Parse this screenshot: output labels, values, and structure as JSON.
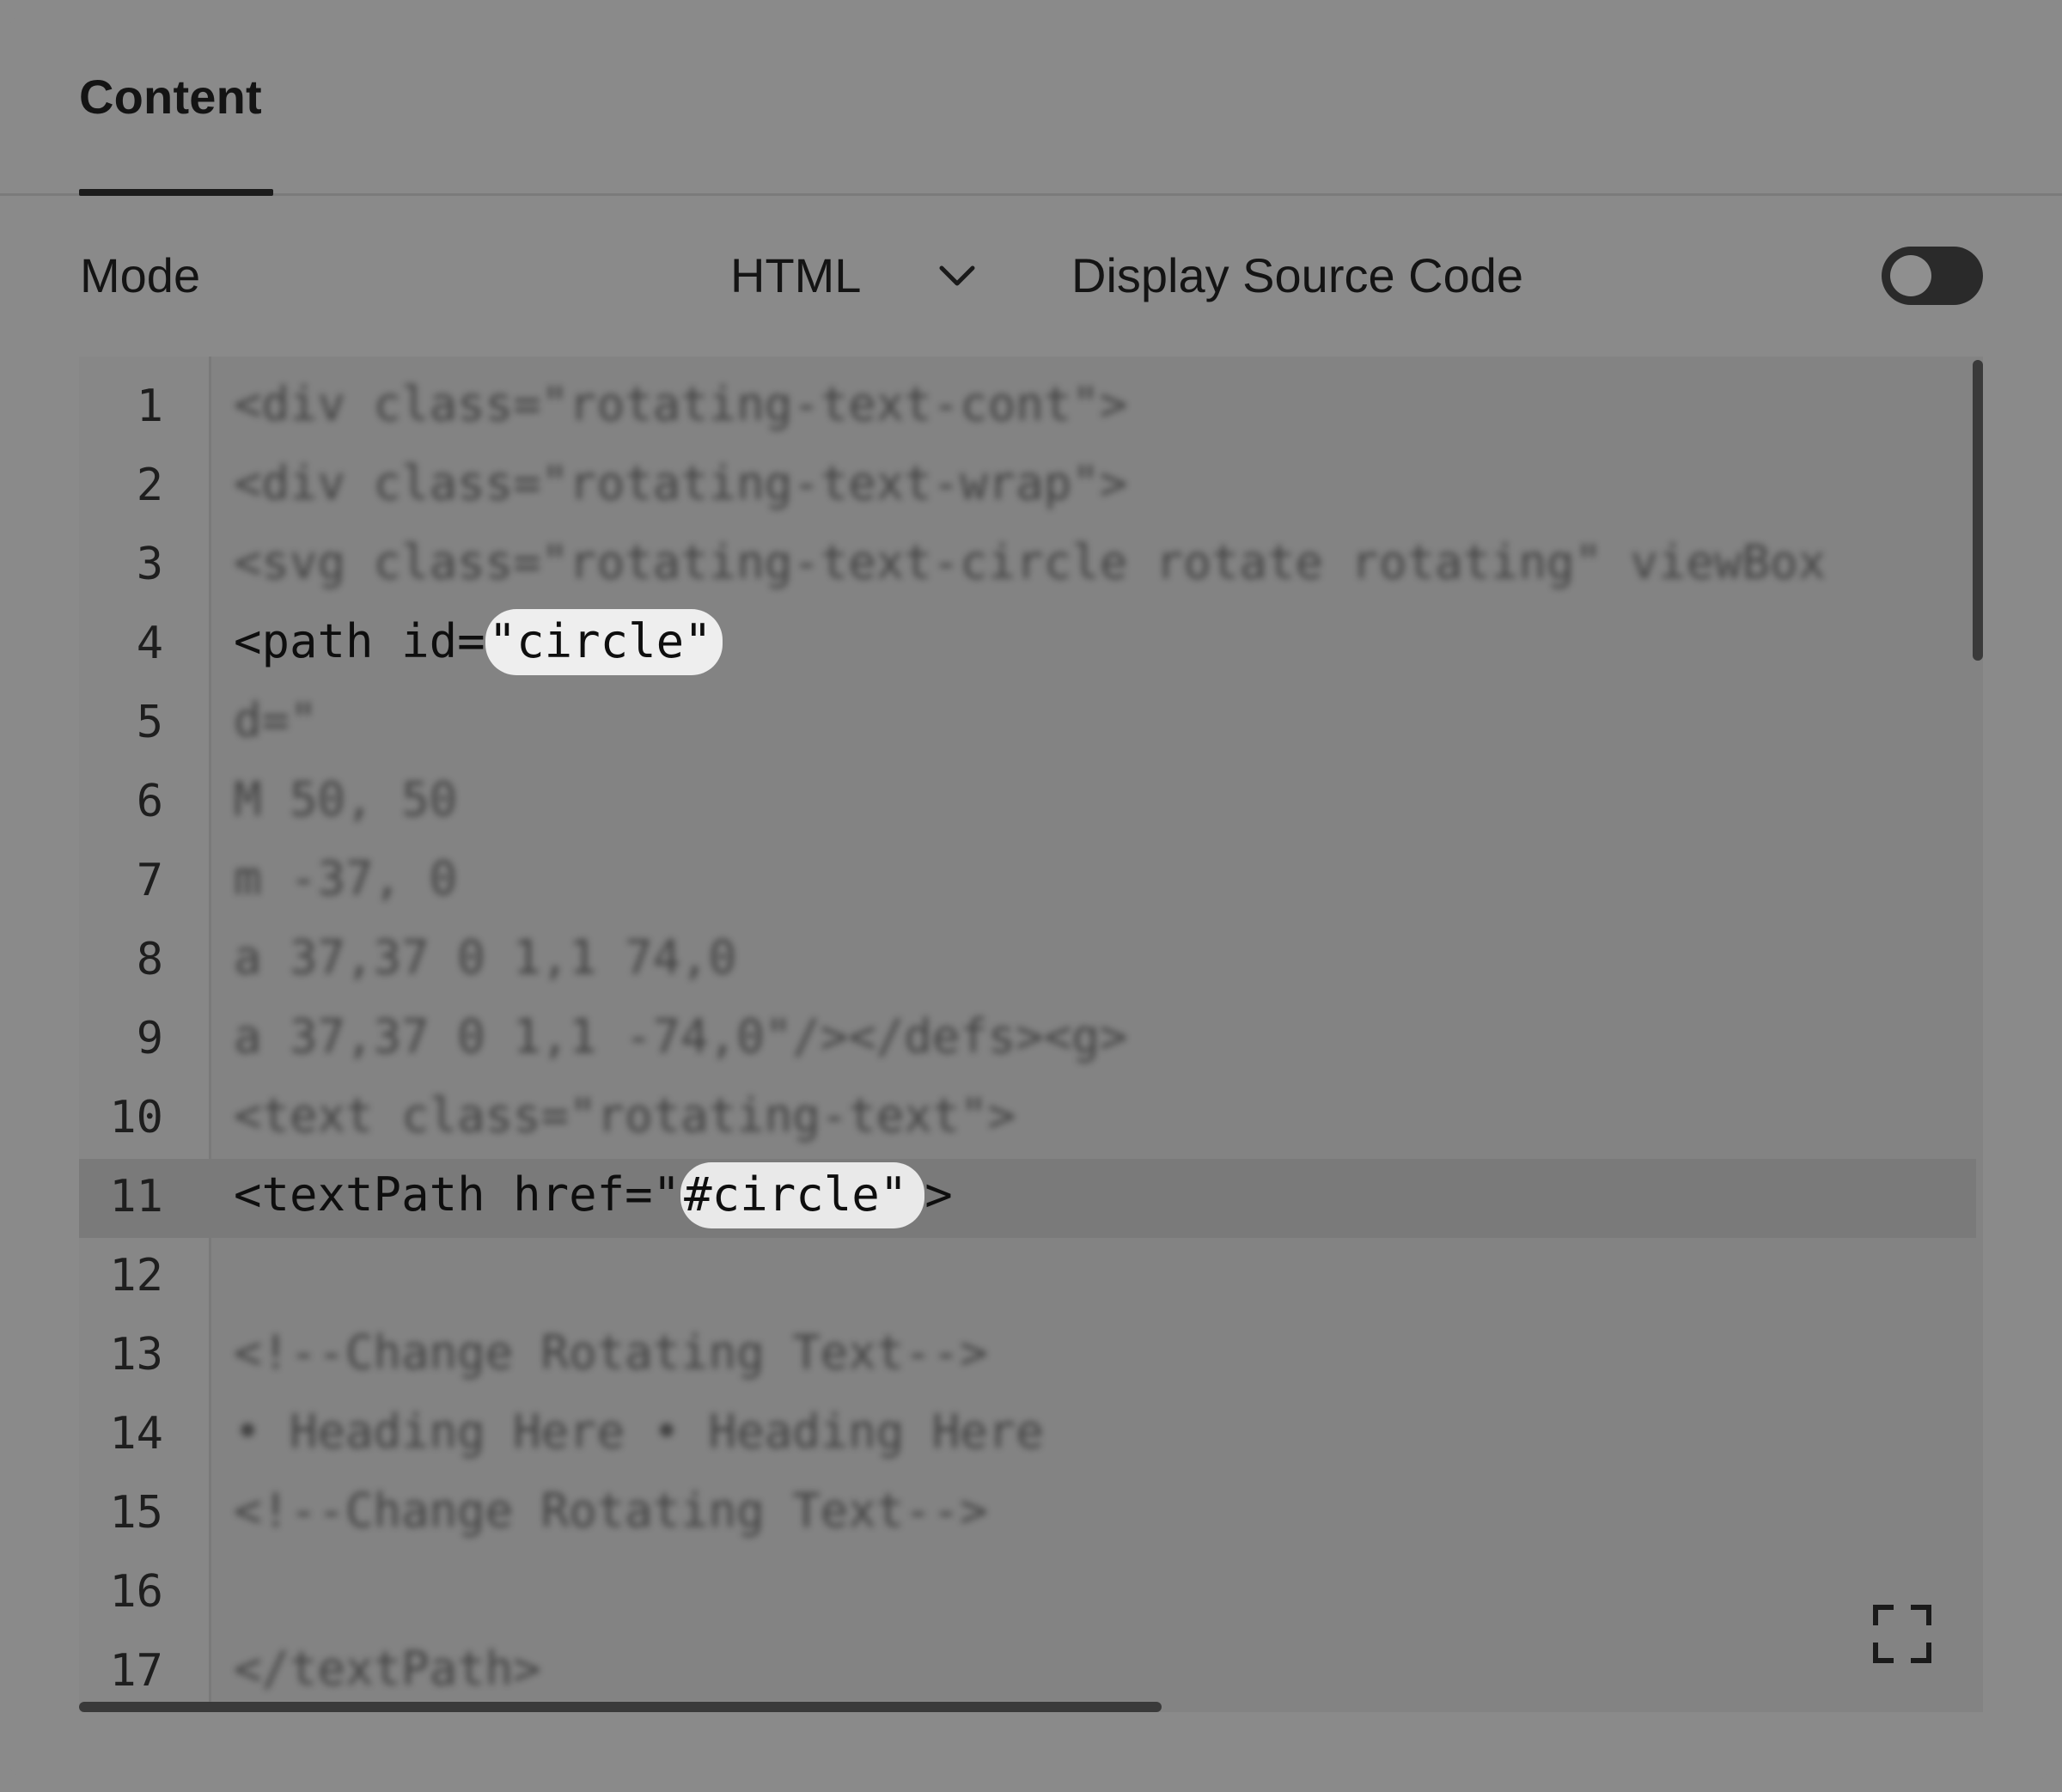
{
  "tabs": [
    {
      "label": "Content"
    }
  ],
  "mode": {
    "label": "Mode",
    "selected": "HTML",
    "display_source_label": "Display Source Code",
    "display_source_enabled": false
  },
  "icons": {
    "mode_dropdown": "chevron-down-icon",
    "expand": "expand-icon"
  },
  "editor": {
    "active_line": 11,
    "lines": [
      {
        "num": "1",
        "text": "<div class=\"rotating-text-cont\">",
        "blurred": true
      },
      {
        "num": "2",
        "text": "<div class=\"rotating-text-wrap\">",
        "blurred": true
      },
      {
        "num": "3",
        "text": "<svg class=\"rotating-text-circle rotate rotating\" viewBox",
        "blurred": true
      },
      {
        "num": "4",
        "pre": "<path id=",
        "highlight": "\"circle\"",
        "post": ""
      },
      {
        "num": "5",
        "text": "d=\"",
        "blurred": true
      },
      {
        "num": "6",
        "text": "M 50, 50",
        "blurred": true
      },
      {
        "num": "7",
        "text": "m -37, 0",
        "blurred": true
      },
      {
        "num": "8",
        "text": "a 37,37 0 1,1 74,0",
        "blurred": true
      },
      {
        "num": "9",
        "text": "a 37,37 0 1,1 -74,0\"/></defs><g>",
        "blurred": true
      },
      {
        "num": "10",
        "text": "<text class=\"rotating-text\">",
        "blurred": true
      },
      {
        "num": "11",
        "pre": "<textPath href=\"",
        "highlight": "#circle\"",
        "post": ">"
      },
      {
        "num": "12",
        "text": ""
      },
      {
        "num": "13",
        "text": "<!--Change Rotating Text-->",
        "blurred": true
      },
      {
        "num": "14",
        "text": "• Heading Here • Heading Here",
        "blurred": true
      },
      {
        "num": "15",
        "text": "<!--Change Rotating Text-->",
        "blurred": true
      },
      {
        "num": "16",
        "text": ""
      },
      {
        "num": "17",
        "text": "</textPath>",
        "blurred": true
      }
    ]
  }
}
